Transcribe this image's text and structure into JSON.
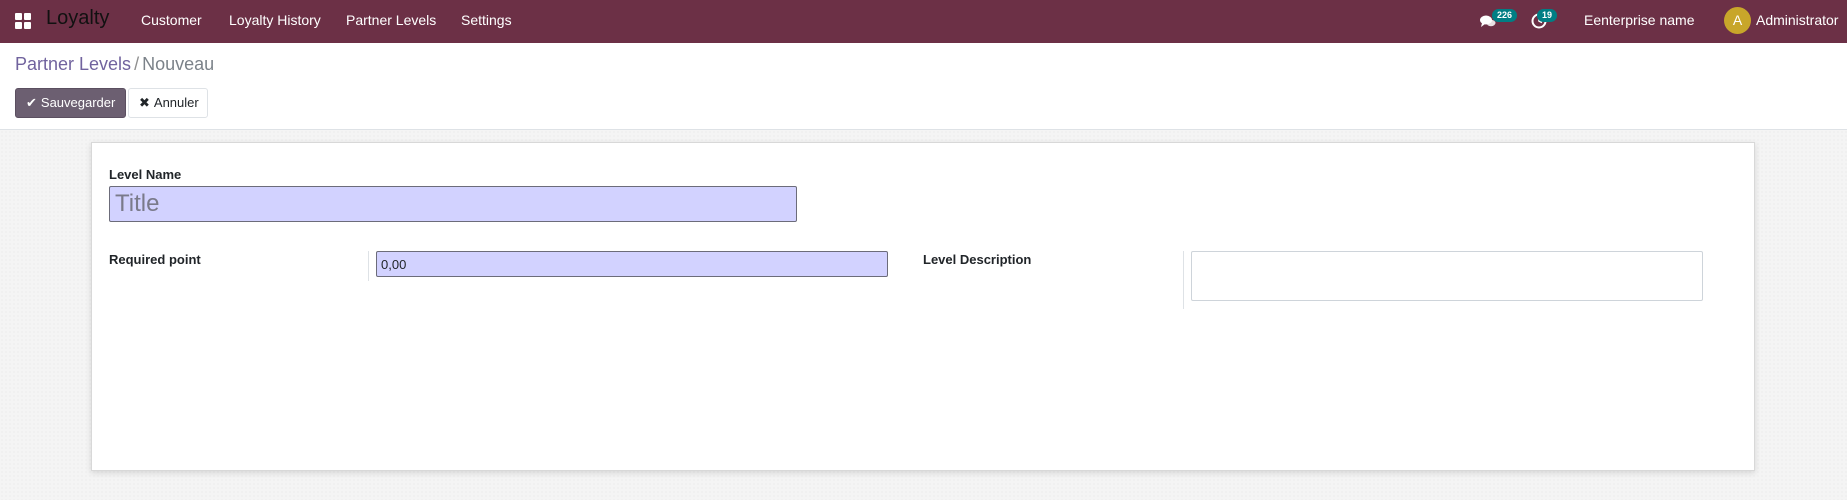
{
  "navbar": {
    "app_name": "Loyalty",
    "menu": [
      {
        "label": "Customer"
      },
      {
        "label": "Loyalty History"
      },
      {
        "label": "Partner Levels"
      },
      {
        "label": "Settings"
      }
    ],
    "messages_count": "226",
    "activities_count": "19",
    "company": "Eenterprise name",
    "avatar_initial": "A",
    "user": "Administrator"
  },
  "breadcrumb": {
    "parent": "Partner Levels",
    "separator": "/",
    "current": "Nouveau"
  },
  "buttons": {
    "save_label": "Sauvegarder",
    "cancel_label": "Annuler"
  },
  "form": {
    "level_name_label": "Level Name",
    "level_name_placeholder": "Title",
    "level_name_value": "",
    "required_point_label": "Required point",
    "required_point_value": "0,00",
    "level_description_label": "Level Description",
    "level_description_value": ""
  },
  "colors": {
    "navbar": "#6c3046",
    "primary_button": "#6c5f71",
    "input_highlight": "#d2d2ff",
    "badge": "#017e84"
  },
  "icons": {
    "apps": "apps-grid-icon",
    "messages": "chat-bubbles-icon",
    "activities": "clock-icon",
    "save": "check-icon",
    "cancel": "times-icon"
  }
}
